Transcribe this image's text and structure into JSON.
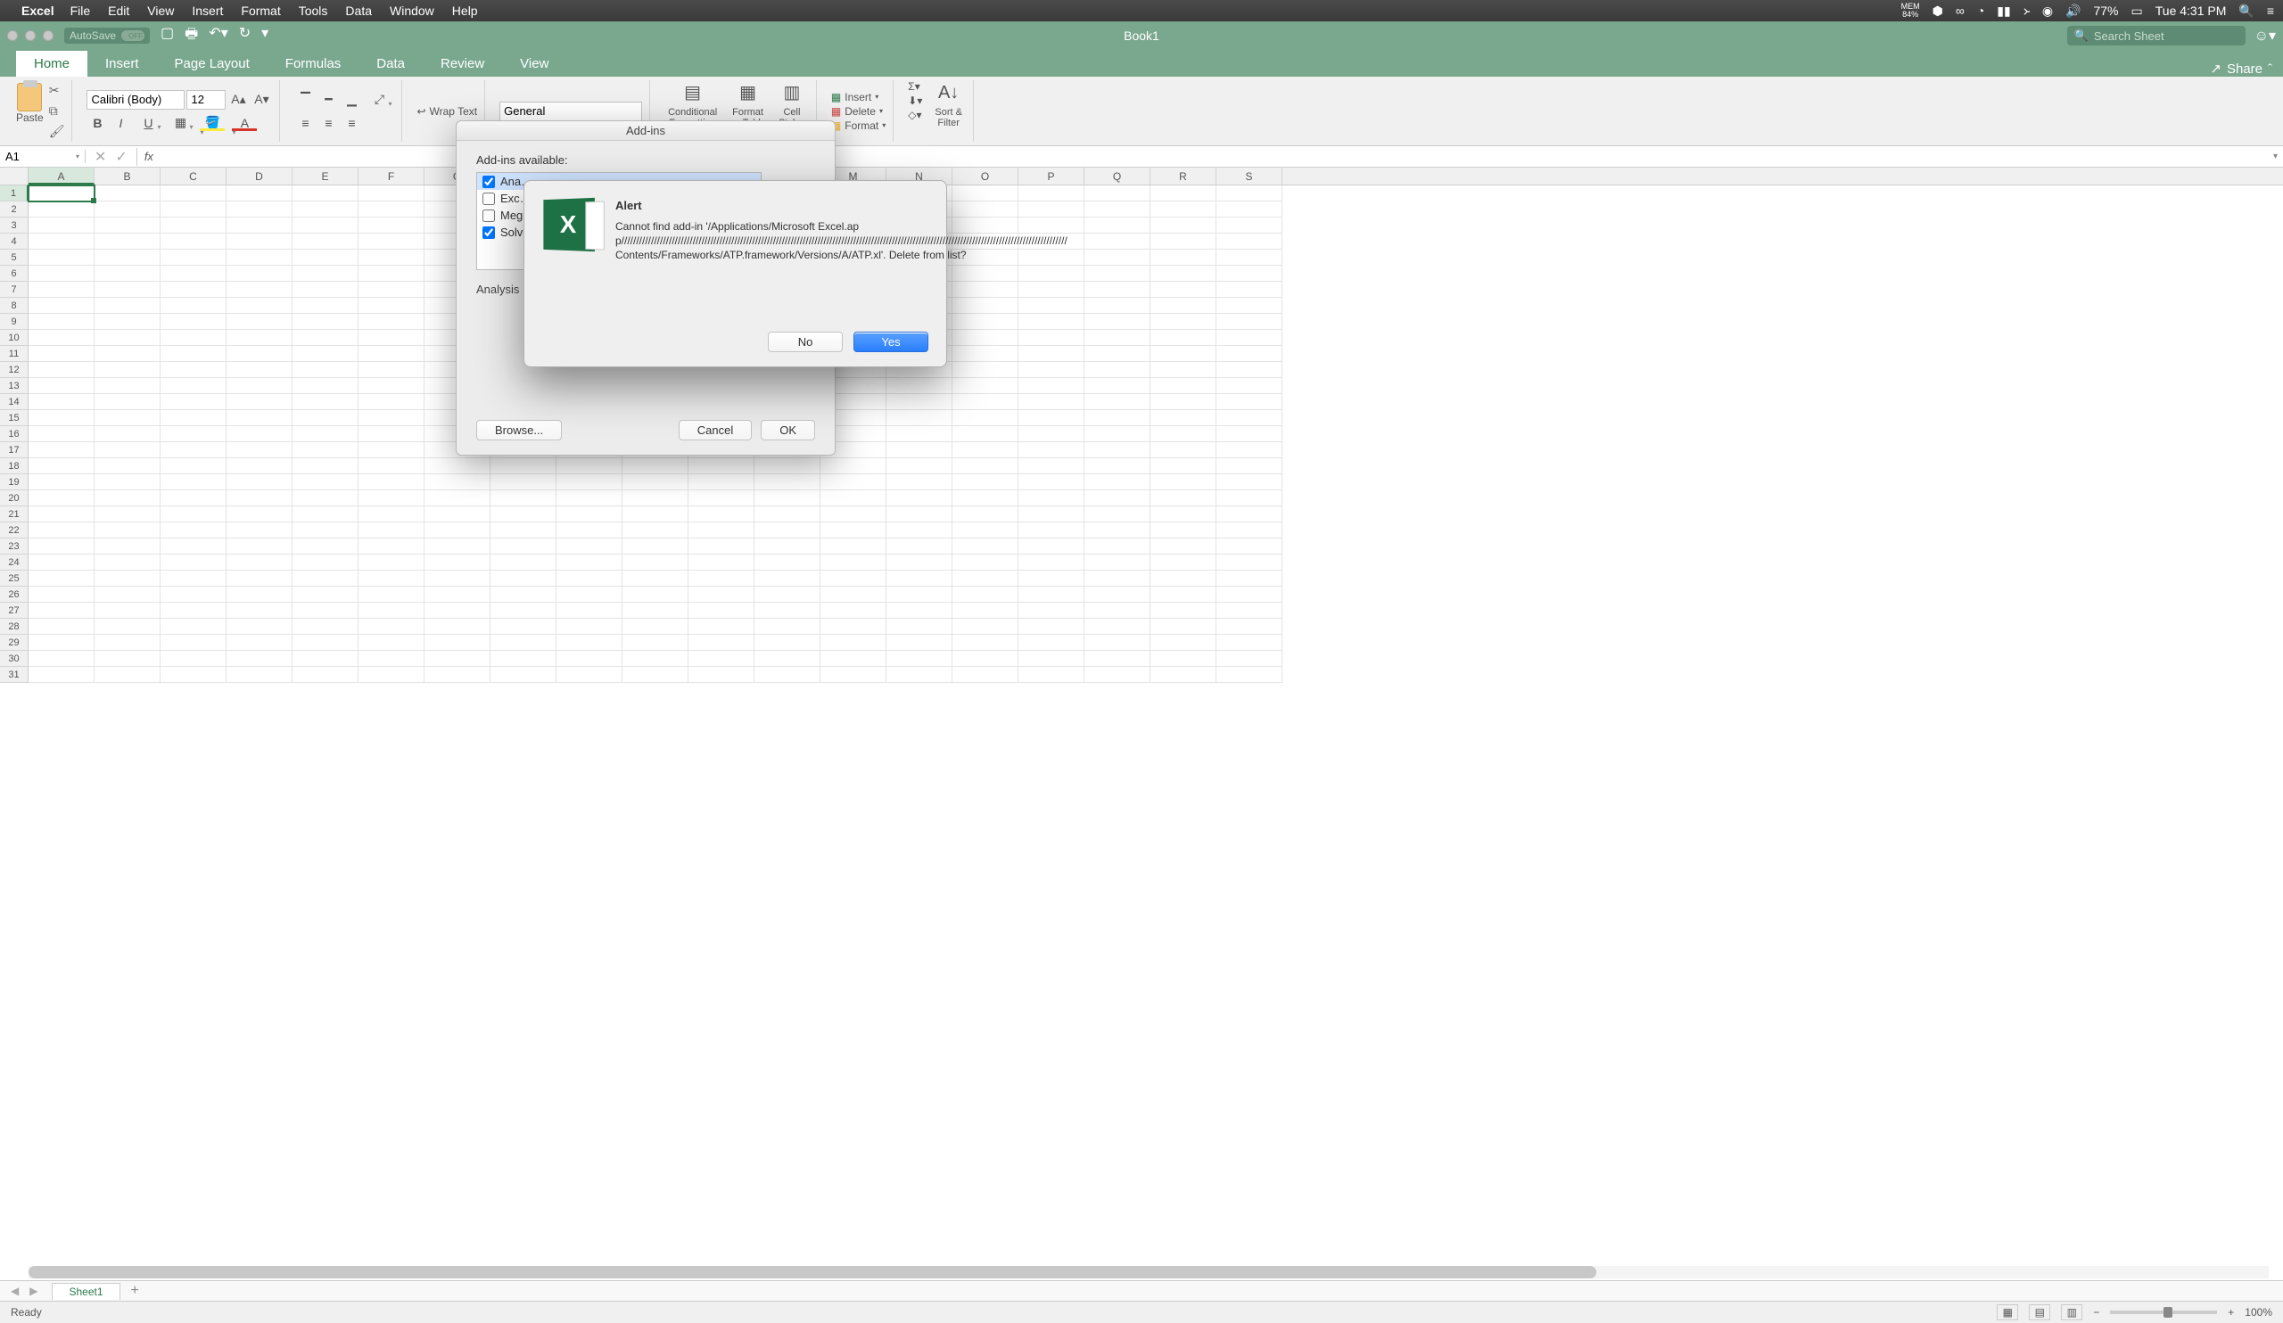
{
  "menubar": {
    "app": "Excel",
    "items": [
      "File",
      "Edit",
      "View",
      "Insert",
      "Format",
      "Tools",
      "Data",
      "Window",
      "Help"
    ],
    "mem_label": "MEM",
    "mem_pct": "84%",
    "battery": "77%",
    "clock": "Tue 4:31 PM"
  },
  "titlebar": {
    "autosave": "AutoSave",
    "autosave_state": "OFF",
    "title": "Book1",
    "search_placeholder": "Search Sheet"
  },
  "ribbon_tabs": [
    "Home",
    "Insert",
    "Page Layout",
    "Formulas",
    "Data",
    "Review",
    "View"
  ],
  "share_label": "Share",
  "ribbon": {
    "paste": "Paste",
    "font": "Calibri (Body)",
    "size": "12",
    "wrap": "Wrap Text",
    "number_format": "General",
    "cond_fmt": "Conditional\nFormatting",
    "fmt_table": "Format\nas Table",
    "cell_styles": "Cell\nStyles",
    "insert": "Insert",
    "delete": "Delete",
    "format": "Format",
    "sort_filter": "Sort &\nFilter"
  },
  "formula": {
    "name_box": "A1"
  },
  "columns": [
    "A",
    "B",
    "C",
    "D",
    "E",
    "F",
    "G",
    "H",
    "I",
    "J",
    "K",
    "L",
    "M",
    "N",
    "O",
    "P",
    "Q",
    "R",
    "S"
  ],
  "row_count": 31,
  "selected_cell": {
    "row": 1,
    "col": 0
  },
  "sheet_tab": "Sheet1",
  "status": {
    "ready": "Ready",
    "zoom": "100%"
  },
  "addins_dialog": {
    "title": "Add-ins",
    "label": "Add-ins available:",
    "items": [
      {
        "label": "Ana…",
        "checked": true,
        "selected": true
      },
      {
        "label": "Exc…",
        "checked": false
      },
      {
        "label": "Meg…",
        "checked": false
      },
      {
        "label": "Solv…",
        "checked": true
      }
    ],
    "desc": "Analysis",
    "browse": "Browse...",
    "cancel": "Cancel",
    "ok": "OK"
  },
  "alert_dialog": {
    "title": "Alert",
    "message": "Cannot find add-in '/Applications/Microsoft Excel.app//////////////////////////////////////////////////////////////////////////////////////////////////////////////////////////////////////////////////////Contents/Frameworks/ATP.framework/Versions/A/ATP.xl'. Delete from list?",
    "no": "No",
    "yes": "Yes"
  }
}
